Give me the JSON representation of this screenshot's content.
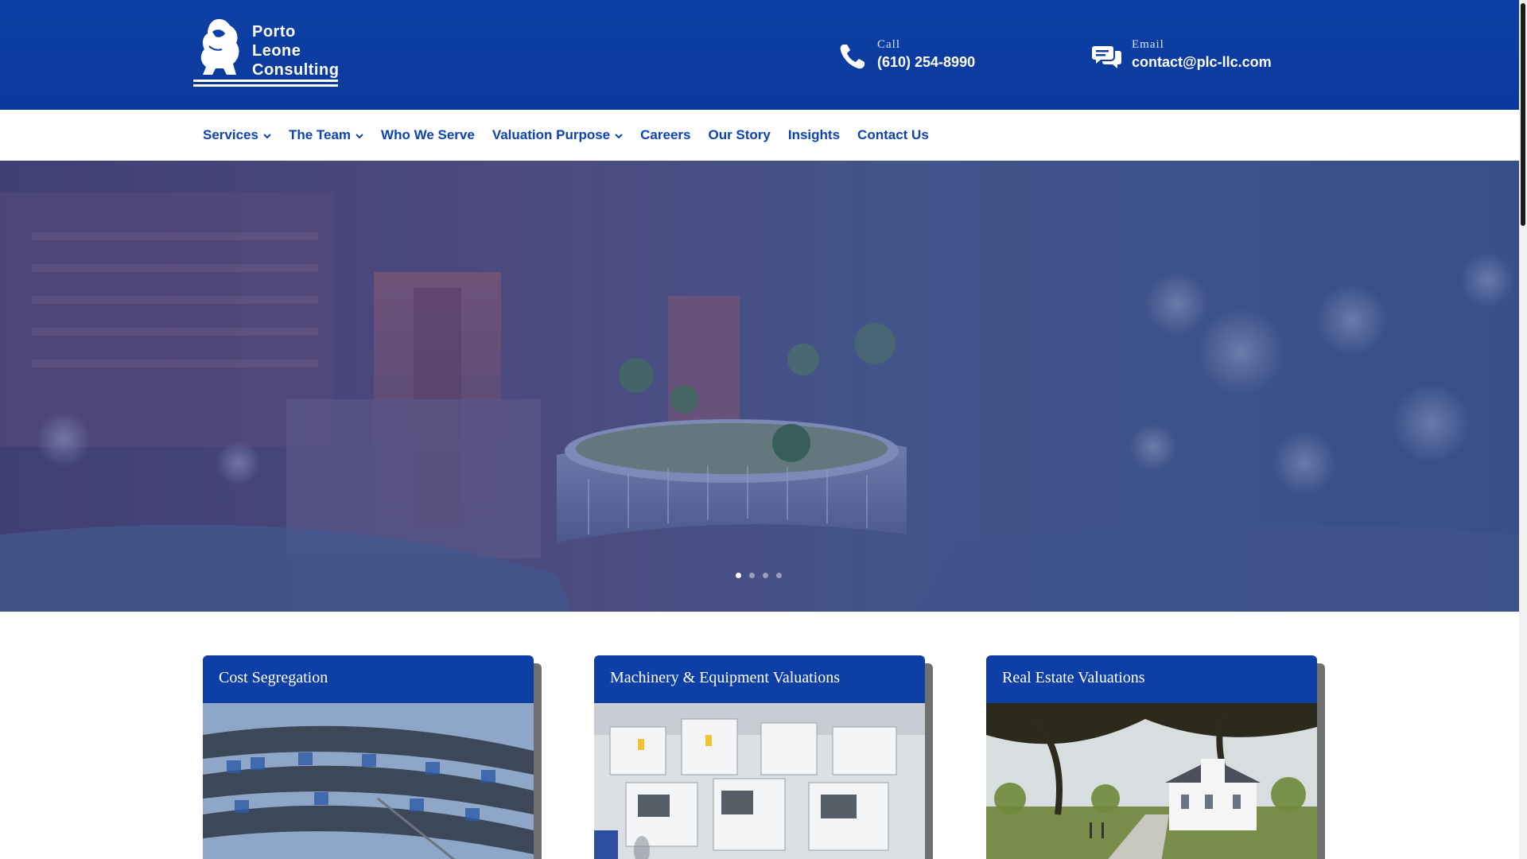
{
  "brand": {
    "logo_lines": [
      "Porto",
      "Leone",
      "Consulting"
    ],
    "primary_color": "#0d3fa6",
    "nav_color": "#0c43b3"
  },
  "contact": {
    "call": {
      "label": "Call",
      "value": "(610) 254-8990",
      "icon": "phone-icon"
    },
    "email": {
      "label": "Email",
      "value": "contact@plc-llc.com",
      "icon": "chat-bubbles-icon"
    }
  },
  "nav": {
    "items": [
      {
        "label": "Services",
        "dropdown": true
      },
      {
        "label": "The Team",
        "dropdown": true
      },
      {
        "label": "Who We Serve",
        "dropdown": false
      },
      {
        "label": "Valuation Purpose",
        "dropdown": true
      },
      {
        "label": "Careers",
        "dropdown": false
      },
      {
        "label": "Our Story",
        "dropdown": false
      },
      {
        "label": "Insights",
        "dropdown": false
      },
      {
        "label": "Contact Us",
        "dropdown": false
      }
    ]
  },
  "hero": {
    "slide_count": 4,
    "active_slide": 1
  },
  "cards": [
    {
      "title": "Cost Segregation"
    },
    {
      "title": "Machinery & Equipment Valuations"
    },
    {
      "title": "Real Estate Valuations"
    }
  ]
}
